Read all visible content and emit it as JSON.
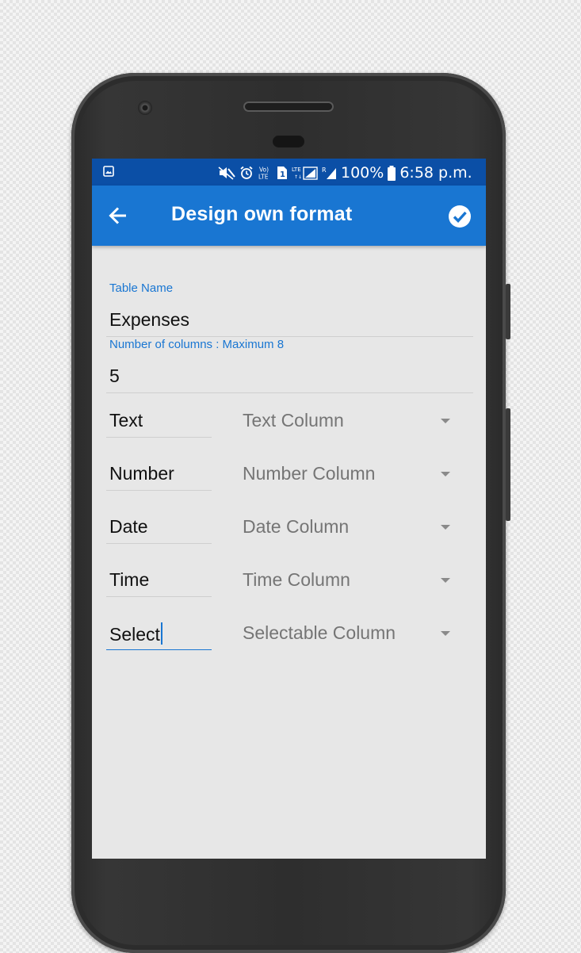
{
  "status_bar": {
    "battery": "100%",
    "time": "6:58 p.m.",
    "sim": "1"
  },
  "app_bar": {
    "title": "Design own format"
  },
  "form": {
    "table_name_label": "Table Name",
    "table_name_value": "Expenses",
    "columns_label": "Number of columns : Maximum 8",
    "columns_value": "5",
    "columns": [
      {
        "name": "Text",
        "type": "Text Column"
      },
      {
        "name": "Number",
        "type": "Number Column"
      },
      {
        "name": "Date",
        "type": "Date Column"
      },
      {
        "name": "Time",
        "type": "Time Column"
      },
      {
        "name": "Select",
        "type": "Selectable Column"
      }
    ]
  },
  "colors": {
    "status_bar": "#0b4fa6",
    "app_bar": "#1976d2",
    "accent": "#1976d2",
    "background": "#e7e7e7"
  },
  "icons": {
    "back": "arrow-left-icon",
    "confirm": "check-circle-icon",
    "dropdown": "triangle-down-icon"
  }
}
